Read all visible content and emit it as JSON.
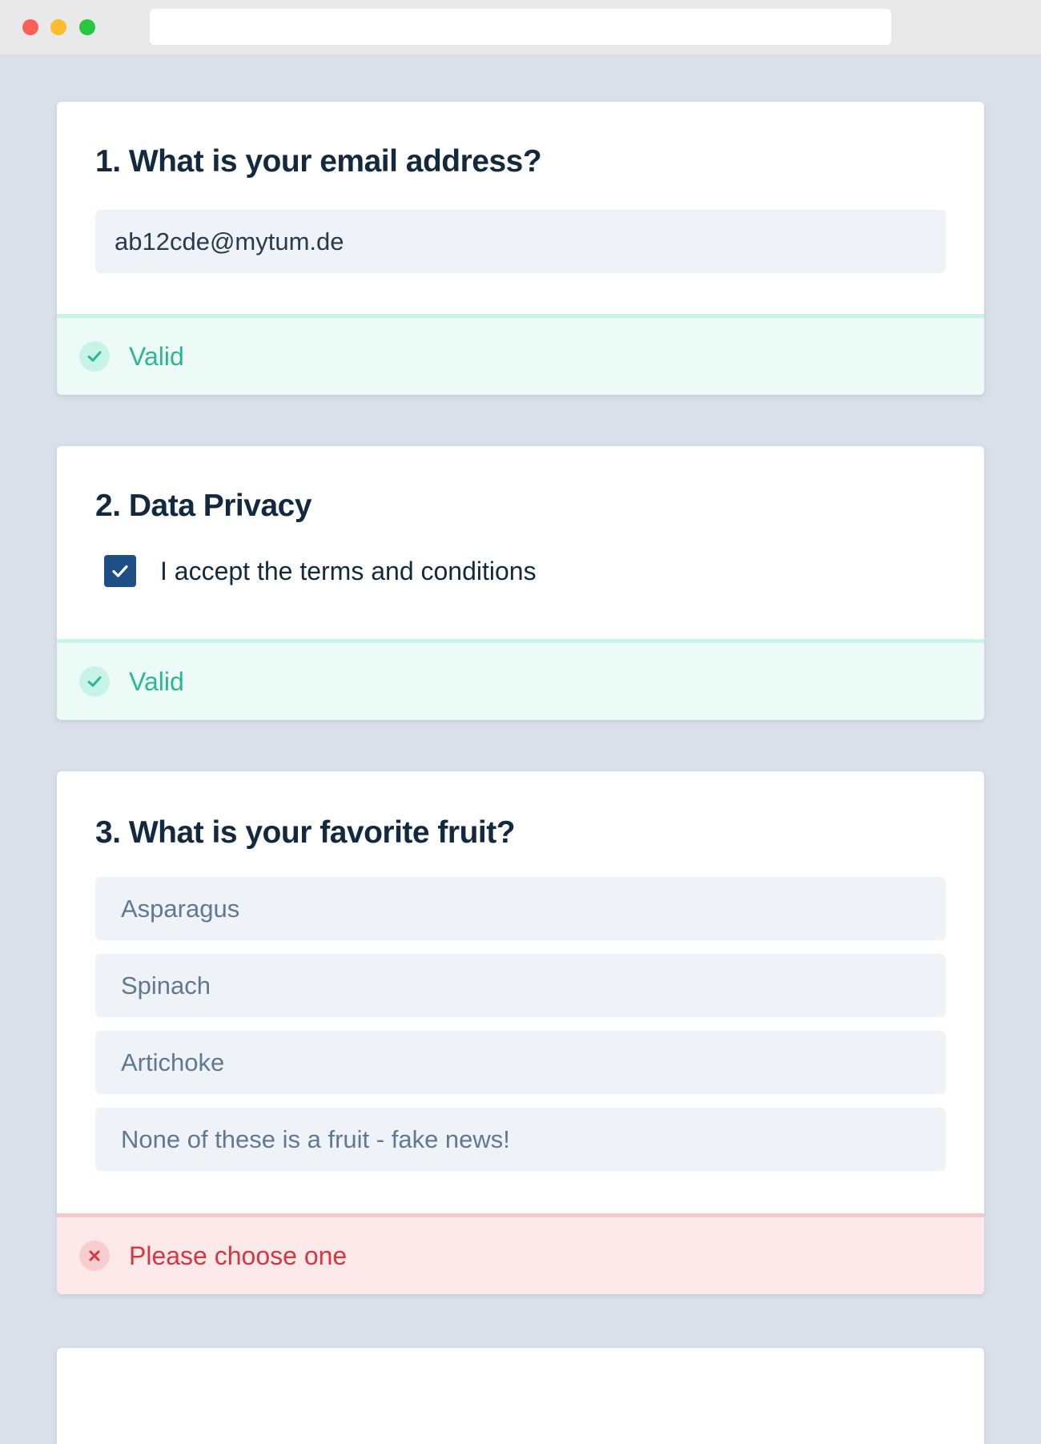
{
  "questions": [
    {
      "title": "1. What is your email address?",
      "input_value": "ab12cde@mytum.de",
      "status": "Valid"
    },
    {
      "title": "2. Data Privacy",
      "checkbox_label": "I accept the terms and conditions",
      "checkbox_checked": true,
      "status": "Valid"
    },
    {
      "title": "3. What is your favorite fruit?",
      "options": [
        "Asparagus",
        "Spinach",
        "Artichoke",
        "None of these is a fruit - fake news!"
      ],
      "status": "Please choose one"
    }
  ],
  "colors": {
    "background": "#dae0ea",
    "valid": "#2cb78e",
    "invalid": "#d6373e",
    "checkbox": "#1d4e86",
    "title": "#13293d"
  },
  "icons": {
    "valid": "check-icon",
    "invalid": "close-icon"
  }
}
